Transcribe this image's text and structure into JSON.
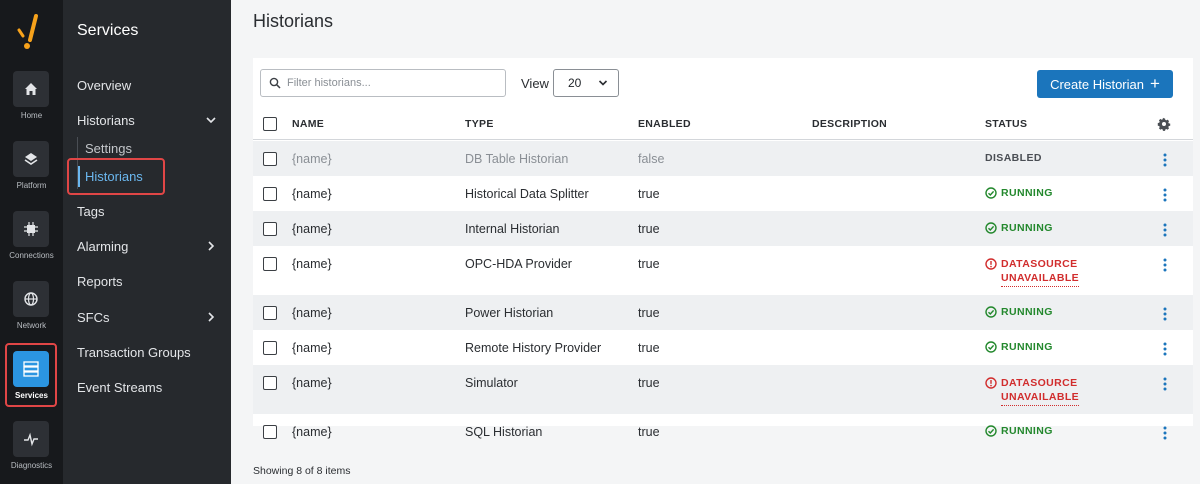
{
  "rail": {
    "items": [
      {
        "label": "Home",
        "icon": "home-icon"
      },
      {
        "label": "Platform",
        "icon": "layers-icon"
      },
      {
        "label": "Connections",
        "icon": "chip-icon"
      },
      {
        "label": "Network",
        "icon": "globe-icon"
      },
      {
        "label": "Services",
        "icon": "server-icon"
      },
      {
        "label": "Diagnostics",
        "icon": "pulse-icon"
      }
    ]
  },
  "sidenav": {
    "title": "Services",
    "items": [
      {
        "label": "Overview"
      },
      {
        "label": "Historians"
      },
      {
        "label": "Settings"
      },
      {
        "label": "Historians"
      },
      {
        "label": "Tags"
      },
      {
        "label": "Alarming"
      },
      {
        "label": "Reports"
      },
      {
        "label": "SFCs"
      },
      {
        "label": "Transaction Groups"
      },
      {
        "label": "Event Streams"
      }
    ]
  },
  "page": {
    "title": "Historians"
  },
  "toolbar": {
    "filter_placeholder": "Filter historians...",
    "view_label": "View",
    "view_value": "20",
    "create_label": "Create Historian",
    "create_icon": "+"
  },
  "table": {
    "columns": [
      "NAME",
      "TYPE",
      "ENABLED",
      "DESCRIPTION",
      "STATUS"
    ],
    "rows": [
      {
        "name": "{name}",
        "type": "DB Table Historian",
        "enabled": "false",
        "description": "",
        "status": "DISABLED",
        "status_line2": ""
      },
      {
        "name": "{name}",
        "type": "Historical Data Splitter",
        "enabled": "true",
        "description": "",
        "status": "RUNNING",
        "status_line2": ""
      },
      {
        "name": "{name}",
        "type": "Internal Historian",
        "enabled": "true",
        "description": "",
        "status": "RUNNING",
        "status_line2": ""
      },
      {
        "name": "{name}",
        "type": "OPC-HDA Provider",
        "enabled": "true",
        "description": "",
        "status": "DATASOURCE",
        "status_line2": "UNAVAILABLE"
      },
      {
        "name": "{name}",
        "type": "Power Historian",
        "enabled": "true",
        "description": "",
        "status": "RUNNING",
        "status_line2": ""
      },
      {
        "name": "{name}",
        "type": "Remote History Provider",
        "enabled": "true",
        "description": "",
        "status": "RUNNING",
        "status_line2": ""
      },
      {
        "name": "{name}",
        "type": "Simulator",
        "enabled": "true",
        "description": "",
        "status": "DATASOURCE",
        "status_line2": "UNAVAILABLE"
      },
      {
        "name": "{name}",
        "type": "SQL Historian",
        "enabled": "true",
        "description": "",
        "status": "RUNNING",
        "status_line2": ""
      }
    ]
  },
  "footer": {
    "text": "Showing 8 of 8 items"
  },
  "colors": {
    "accent": "#1b75bc",
    "running": "#23882d",
    "error": "#d12d2d",
    "highlight": "#e04646",
    "rail_bg": "#17191c",
    "sidenav_bg": "#26292d"
  }
}
